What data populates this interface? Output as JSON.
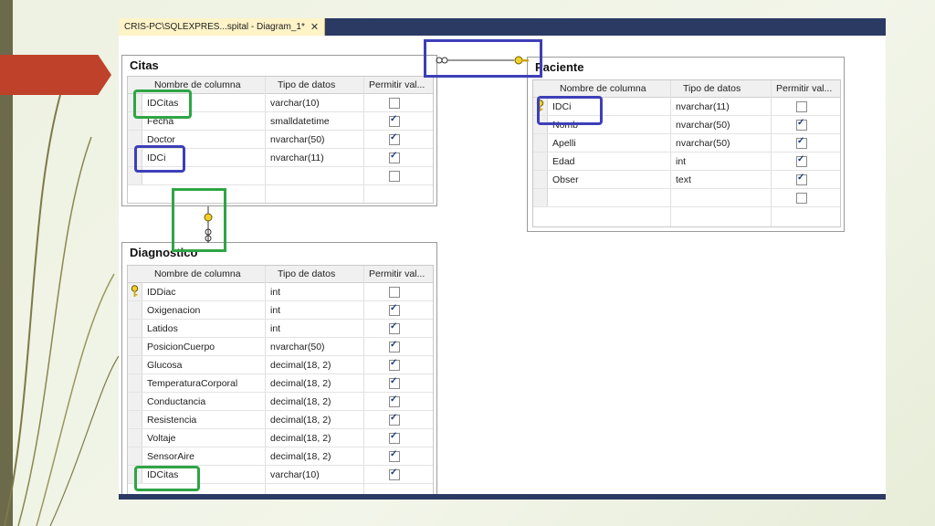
{
  "tab": {
    "title": "CRIS-PC\\SQLEXPRES...spital - Diagram_1*",
    "close": "✕"
  },
  "headers": {
    "name": "Nombre de columna",
    "type": "Tipo de datos",
    "null": "Permitir val..."
  },
  "citas": {
    "title": "Citas",
    "rows": [
      {
        "name": "IDCitas",
        "type": "varchar(10)",
        "allow": false
      },
      {
        "name": "Fecha",
        "type": "smalldatetime",
        "allow": true
      },
      {
        "name": "Doctor",
        "type": "nvarchar(50)",
        "allow": true
      },
      {
        "name": "IDCi",
        "type": "nvarchar(11)",
        "allow": true
      },
      {
        "name": "",
        "type": "",
        "allow": false
      }
    ]
  },
  "paciente": {
    "title": "Paciente",
    "rows": [
      {
        "name": "IDCi",
        "type": "nvarchar(11)",
        "allow": false,
        "key": true
      },
      {
        "name": "Nomb",
        "type": "nvarchar(50)",
        "allow": true
      },
      {
        "name": "Apelli",
        "type": "nvarchar(50)",
        "allow": true
      },
      {
        "name": "Edad",
        "type": "int",
        "allow": true
      },
      {
        "name": "Obser",
        "type": "text",
        "allow": true
      },
      {
        "name": "",
        "type": "",
        "allow": false
      }
    ]
  },
  "diagnostico": {
    "title": "Diagnostico",
    "rows": [
      {
        "name": "IDDiac",
        "type": "int",
        "allow": false,
        "key": true
      },
      {
        "name": "Oxigenacion",
        "type": "int",
        "allow": true
      },
      {
        "name": "Latidos",
        "type": "int",
        "allow": true
      },
      {
        "name": "PosicionCuerpo",
        "type": "nvarchar(50)",
        "allow": true
      },
      {
        "name": "Glucosa",
        "type": "decimal(18, 2)",
        "allow": true
      },
      {
        "name": "TemperaturaCorporal",
        "type": "decimal(18, 2)",
        "allow": true
      },
      {
        "name": "Conductancia",
        "type": "decimal(18, 2)",
        "allow": true
      },
      {
        "name": "Resistencia",
        "type": "decimal(18, 2)",
        "allow": true
      },
      {
        "name": "Voltaje",
        "type": "decimal(18, 2)",
        "allow": true
      },
      {
        "name": "SensorAire",
        "type": "decimal(18, 2)",
        "allow": true
      },
      {
        "name": "IDCitas",
        "type": "varchar(10)",
        "allow": true
      }
    ]
  },
  "colors": {
    "highlight_blue": "#3d3fb8",
    "highlight_green": "#2fa545",
    "accent_red": "#c0412a"
  }
}
